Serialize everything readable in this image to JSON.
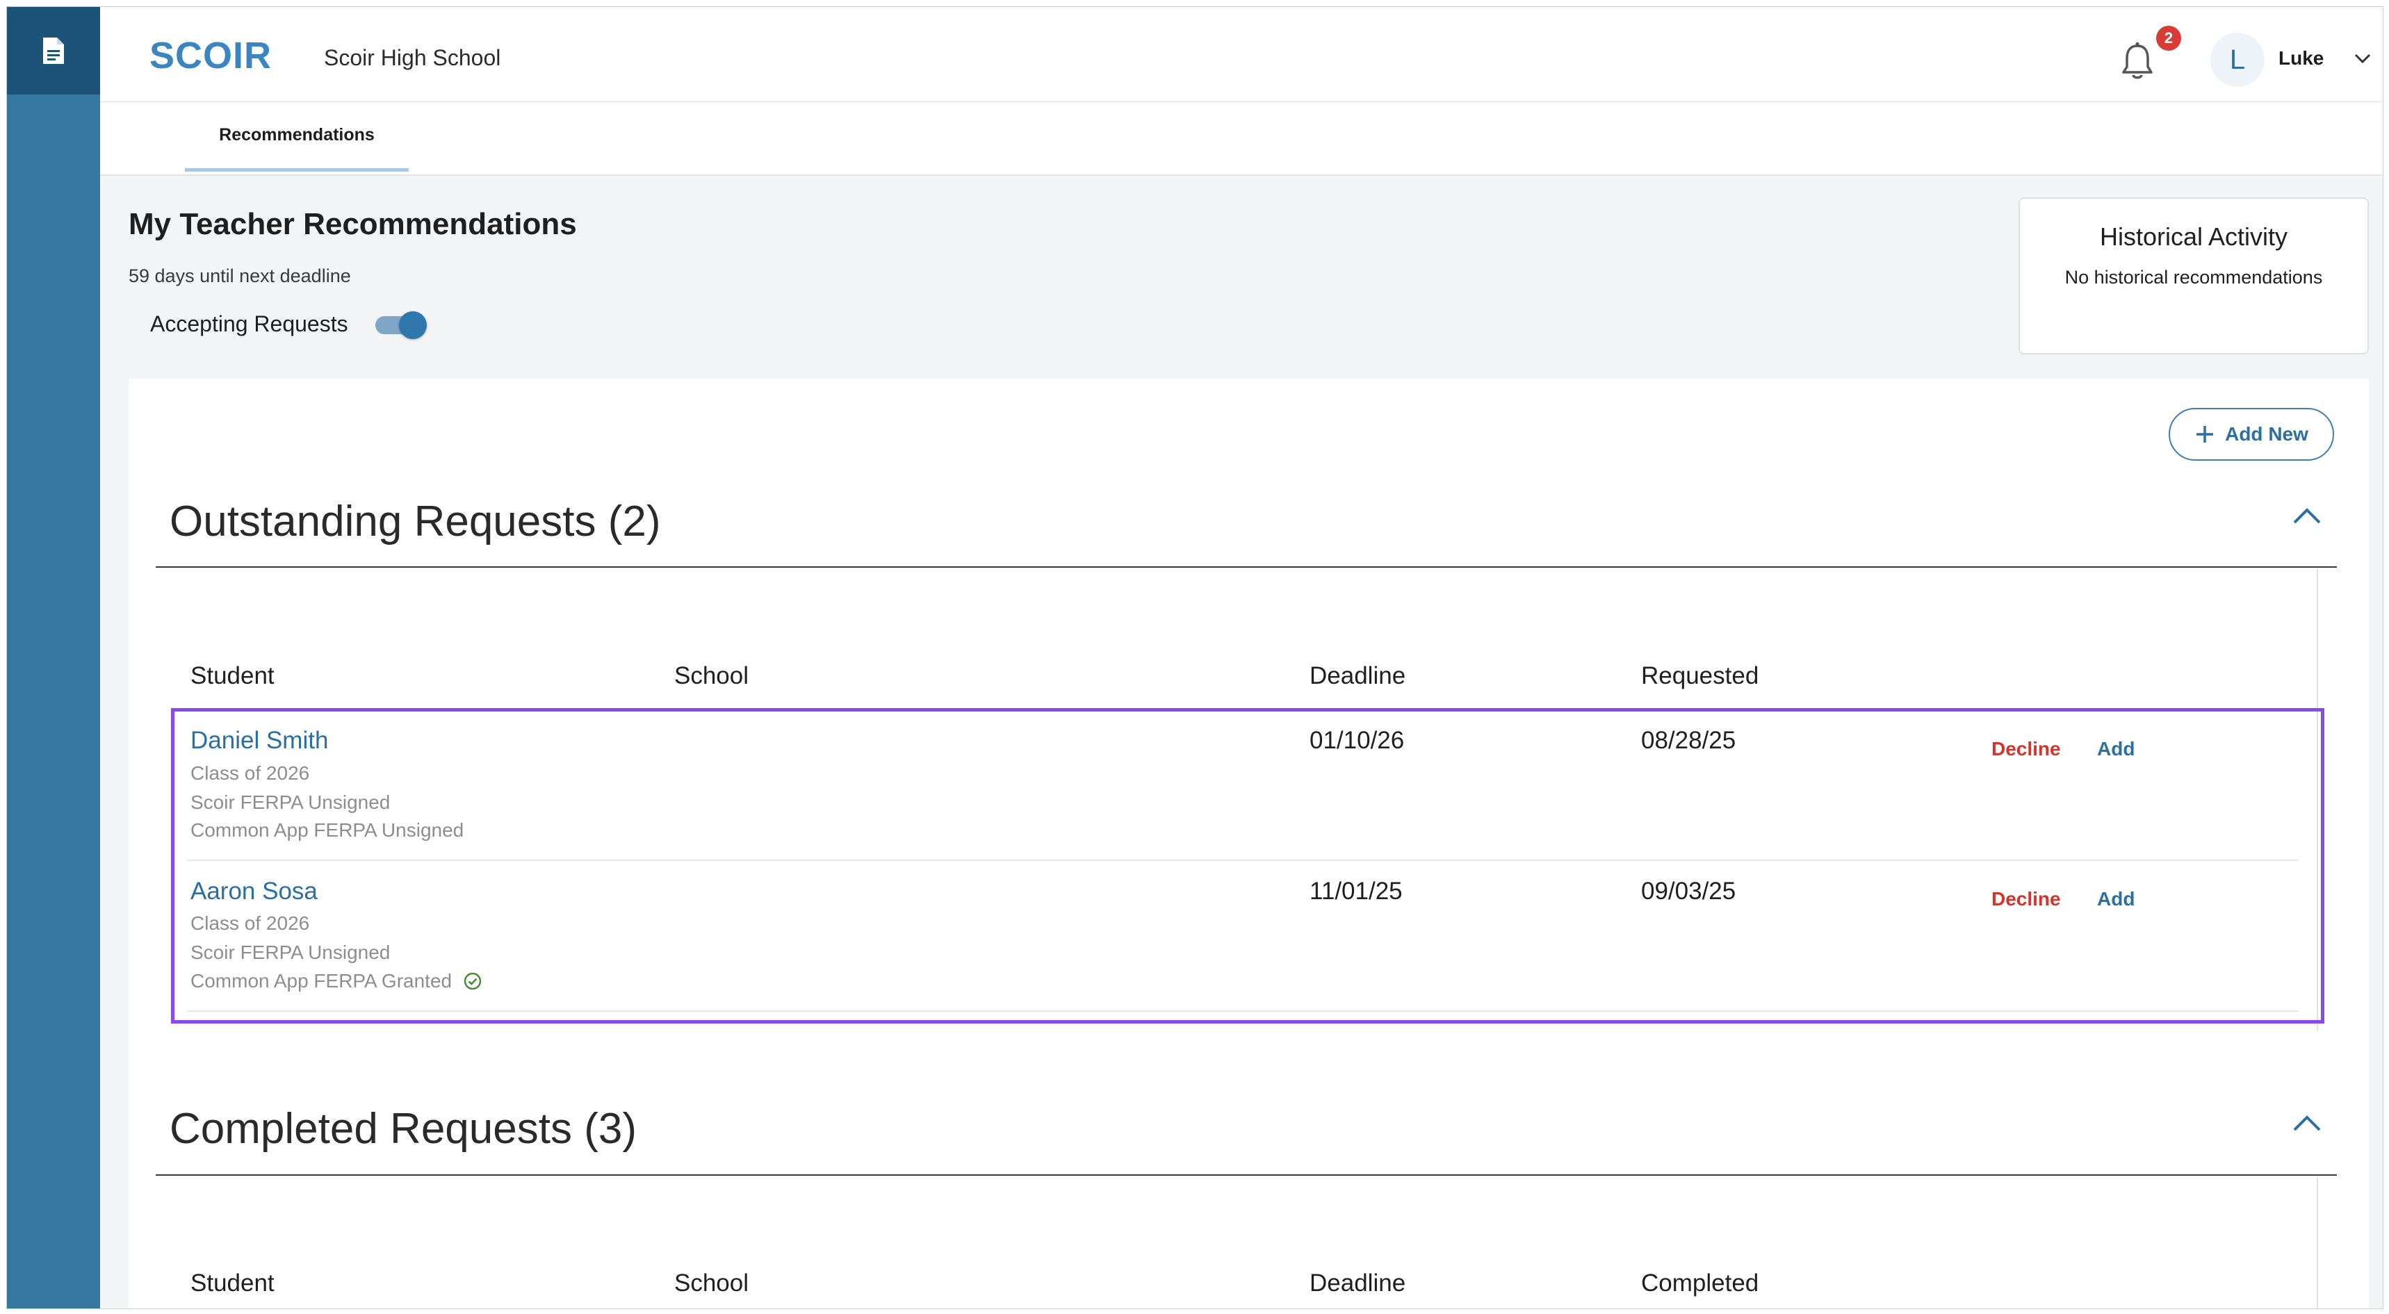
{
  "app": {
    "logo_text": "SCOIR",
    "school": "Scoir High School",
    "notifications_count": "2",
    "user_initial": "L",
    "user_name": "Luke"
  },
  "tabs": [
    {
      "label": "Recommendations",
      "active": true
    }
  ],
  "page": {
    "title": "My Teacher Recommendations",
    "deadline_note": "59 days until next deadline",
    "accepting_label": "Accepting Requests",
    "accepting_on": true
  },
  "historical": {
    "title": "Historical Activity",
    "text": "No historical recommendations"
  },
  "add_new_label": "Add New",
  "outstanding": {
    "title": "Outstanding Requests (2)",
    "columns": [
      "Student",
      "School",
      "Deadline",
      "Requested"
    ],
    "rows": [
      {
        "name": "Daniel Smith",
        "class": "Class of 2026",
        "scoir_ferpa": "Scoir FERPA Unsigned",
        "common_ferpa": "Common App FERPA Unsigned",
        "deadline": "01/10/26",
        "requested": "08/28/25",
        "decline": "Decline",
        "add": "Add"
      },
      {
        "name": "Aaron Sosa",
        "class": "Class of 2026",
        "scoir_ferpa": "Scoir FERPA Unsigned",
        "common_ferpa": "Common App FERPA Granted",
        "deadline": "11/01/25",
        "requested": "09/03/25",
        "decline": "Decline",
        "add": "Add"
      }
    ]
  },
  "completed": {
    "title": "Completed Requests (3)",
    "columns": [
      "Student",
      "School",
      "Deadline",
      "Completed"
    ]
  },
  "colors": {
    "rail": "#3778a3",
    "rail_top": "#1d5378",
    "accent": "#2c6fa3",
    "decline": "#d3352c",
    "highlight": "#8a4af0",
    "badge": "#d93b36"
  }
}
